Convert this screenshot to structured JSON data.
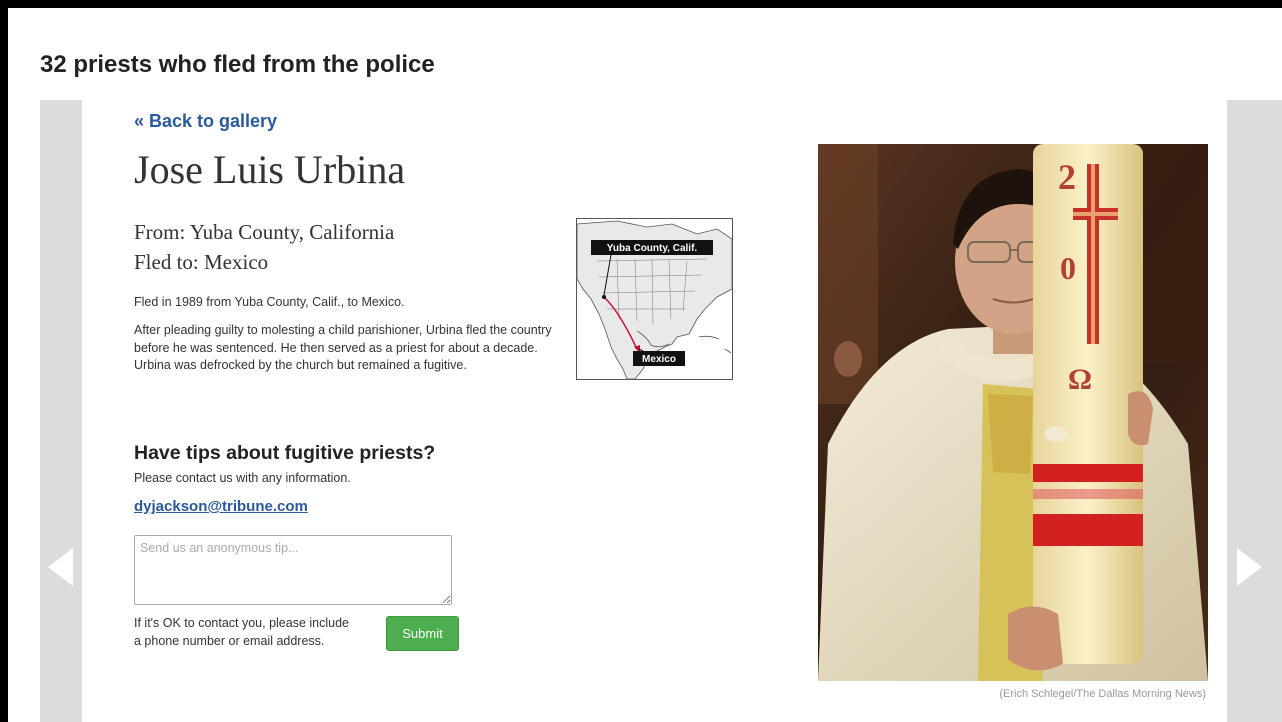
{
  "gallery": {
    "title": "32 priests who fled from the police"
  },
  "nav": {
    "back_label": "« Back to gallery"
  },
  "priest": {
    "name": "Jose Luis Urbina",
    "from": "From: Yuba County, California",
    "fled_to": "Fled to: Mexico",
    "summary": "Fled in 1989 from Yuba County, Calif., to Mexico.",
    "description": "After pleading guilty to molesting a child parishioner, Urbina fled the country before he was sentenced. He then served as a priest for about a decade. Urbina was defrocked by the church but remained a fugitive."
  },
  "map": {
    "origin_label": "Yuba County, Calif.",
    "destination_label": "Mexico",
    "route_color": "#c8102e"
  },
  "tips": {
    "title": "Have tips about fugitive priests?",
    "subtitle": "Please contact us with any information.",
    "email": "dyjackson@tribune.com",
    "placeholder": "Send us an anonymous tip...",
    "contact_note": "If it's OK to contact you, please include a phone number or email address.",
    "submit_label": "Submit"
  },
  "photo": {
    "credit": "(Erich Schlegel/The Dallas Morning News)"
  },
  "colors": {
    "link": "#2a5a9e",
    "submit": "#4cae4c",
    "gutter": "#dcdcdc"
  },
  "icons": {
    "prev": "chevron-left-icon",
    "next": "chevron-right-icon"
  }
}
